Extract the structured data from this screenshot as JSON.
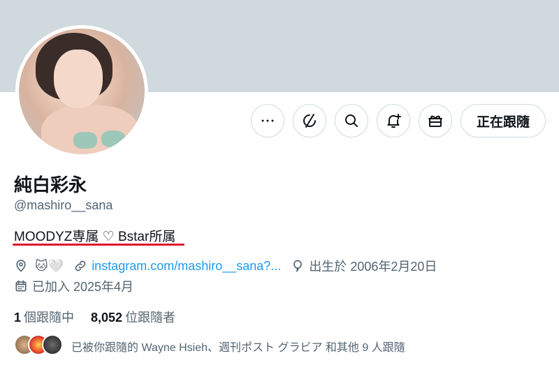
{
  "profile": {
    "name": "純白彩永",
    "handle": "@mashiro__sana",
    "bio": "MOODYZ専属 ♡ Bstar所属",
    "location_emoji": "🐱🤍",
    "link": "instagram.com/mashiro__sana?...",
    "birthday": "出生於 2006年2月20日",
    "joined": "已加入 2025年4月"
  },
  "stats": {
    "following_count": "1",
    "following_label": "個跟隨中",
    "followers_count": "8,052",
    "followers_label": "位跟隨者"
  },
  "followed_by": "已被你跟隨的 Wayne Hsieh、週刊ポスト グラビア 和其他 9 人跟隨",
  "actions": {
    "follow_label": "正在跟隨"
  },
  "colors": {
    "banner": "#cfd9de",
    "link": "#1d9bf0",
    "underline": "#e0152d"
  },
  "icons": [
    "more-icon",
    "grok-icon",
    "search-icon",
    "notification-add-icon",
    "gift-icon",
    "location-icon",
    "link-icon",
    "balloon-icon",
    "calendar-icon"
  ]
}
